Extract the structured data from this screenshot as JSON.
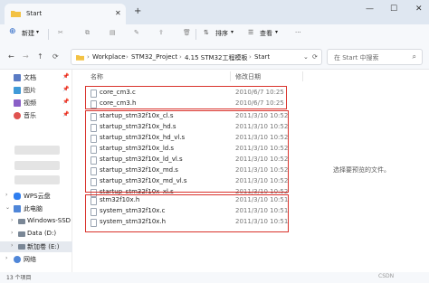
{
  "window": {
    "tab_title": "Start",
    "new_tab": "+",
    "close_tab": "✕",
    "minimize": "—",
    "maximize": "☐",
    "close": "✕"
  },
  "toolbar": {
    "new_label": "新建",
    "sort_label": "排序",
    "view_label": "查看",
    "more_label": "···"
  },
  "address": {
    "crumbs": [
      "Workplace",
      "STM32_Project",
      "4.15 STM32工程模板",
      "Start"
    ],
    "search_placeholder": "在 Start 中搜索"
  },
  "sidebar": {
    "items": [
      {
        "label": "文档",
        "pinned": true,
        "color": "#5a7bc4"
      },
      {
        "label": "图片",
        "pinned": true,
        "color": "#3f9ad8"
      },
      {
        "label": "视频",
        "pinned": true,
        "color": "#8a5fc7"
      },
      {
        "label": "音乐",
        "pinned": true,
        "color": "#e0524f"
      },
      {
        "label": "WPS云盘",
        "pinned": false,
        "color": "#2f7ef0"
      },
      {
        "label": "此电脑",
        "pinned": false,
        "color": "#4f86d8"
      },
      {
        "label": "Windows-SSD",
        "pinned": false,
        "color": "#7a8796"
      },
      {
        "label": "Data (D:)",
        "pinned": false,
        "color": "#7a8796"
      },
      {
        "label": "新加卷 (E:)",
        "pinned": false,
        "color": "#7a8796"
      },
      {
        "label": "网络",
        "pinned": false,
        "color": "#4f86d8"
      }
    ]
  },
  "file_list": {
    "columns": [
      "名称",
      "修改日期"
    ],
    "files": [
      {
        "name": "core_cm3.c",
        "date": "2010/6/7 10:25"
      },
      {
        "name": "core_cm3.h",
        "date": "2010/6/7 10:25"
      },
      {
        "name": "startup_stm32f10x_cl.s",
        "date": "2011/3/10 10:52"
      },
      {
        "name": "startup_stm32f10x_hd.s",
        "date": "2011/3/10 10:52"
      },
      {
        "name": "startup_stm32f10x_hd_vl.s",
        "date": "2011/3/10 10:52"
      },
      {
        "name": "startup_stm32f10x_ld.s",
        "date": "2011/3/10 10:52"
      },
      {
        "name": "startup_stm32f10x_ld_vl.s",
        "date": "2011/3/10 10:52"
      },
      {
        "name": "startup_stm32f10x_md.s",
        "date": "2011/3/10 10:52"
      },
      {
        "name": "startup_stm32f10x_md_vl.s",
        "date": "2011/3/10 10:52"
      },
      {
        "name": "startup_stm32f10x_xl.s",
        "date": "2011/3/10 10:52"
      },
      {
        "name": "stm32f10x.h",
        "date": "2011/3/10 10:51"
      },
      {
        "name": "system_stm32f10x.c",
        "date": "2011/3/10 10:51"
      },
      {
        "name": "system_stm32f10x.h",
        "date": "2011/3/10 10:51"
      }
    ]
  },
  "preview_text": "选择要预览的文件。",
  "status": {
    "count": "13 个项目",
    "watermark": "CSDN"
  },
  "colors": {
    "highlight_box": "#d9322b",
    "folder": "#f3c244"
  }
}
